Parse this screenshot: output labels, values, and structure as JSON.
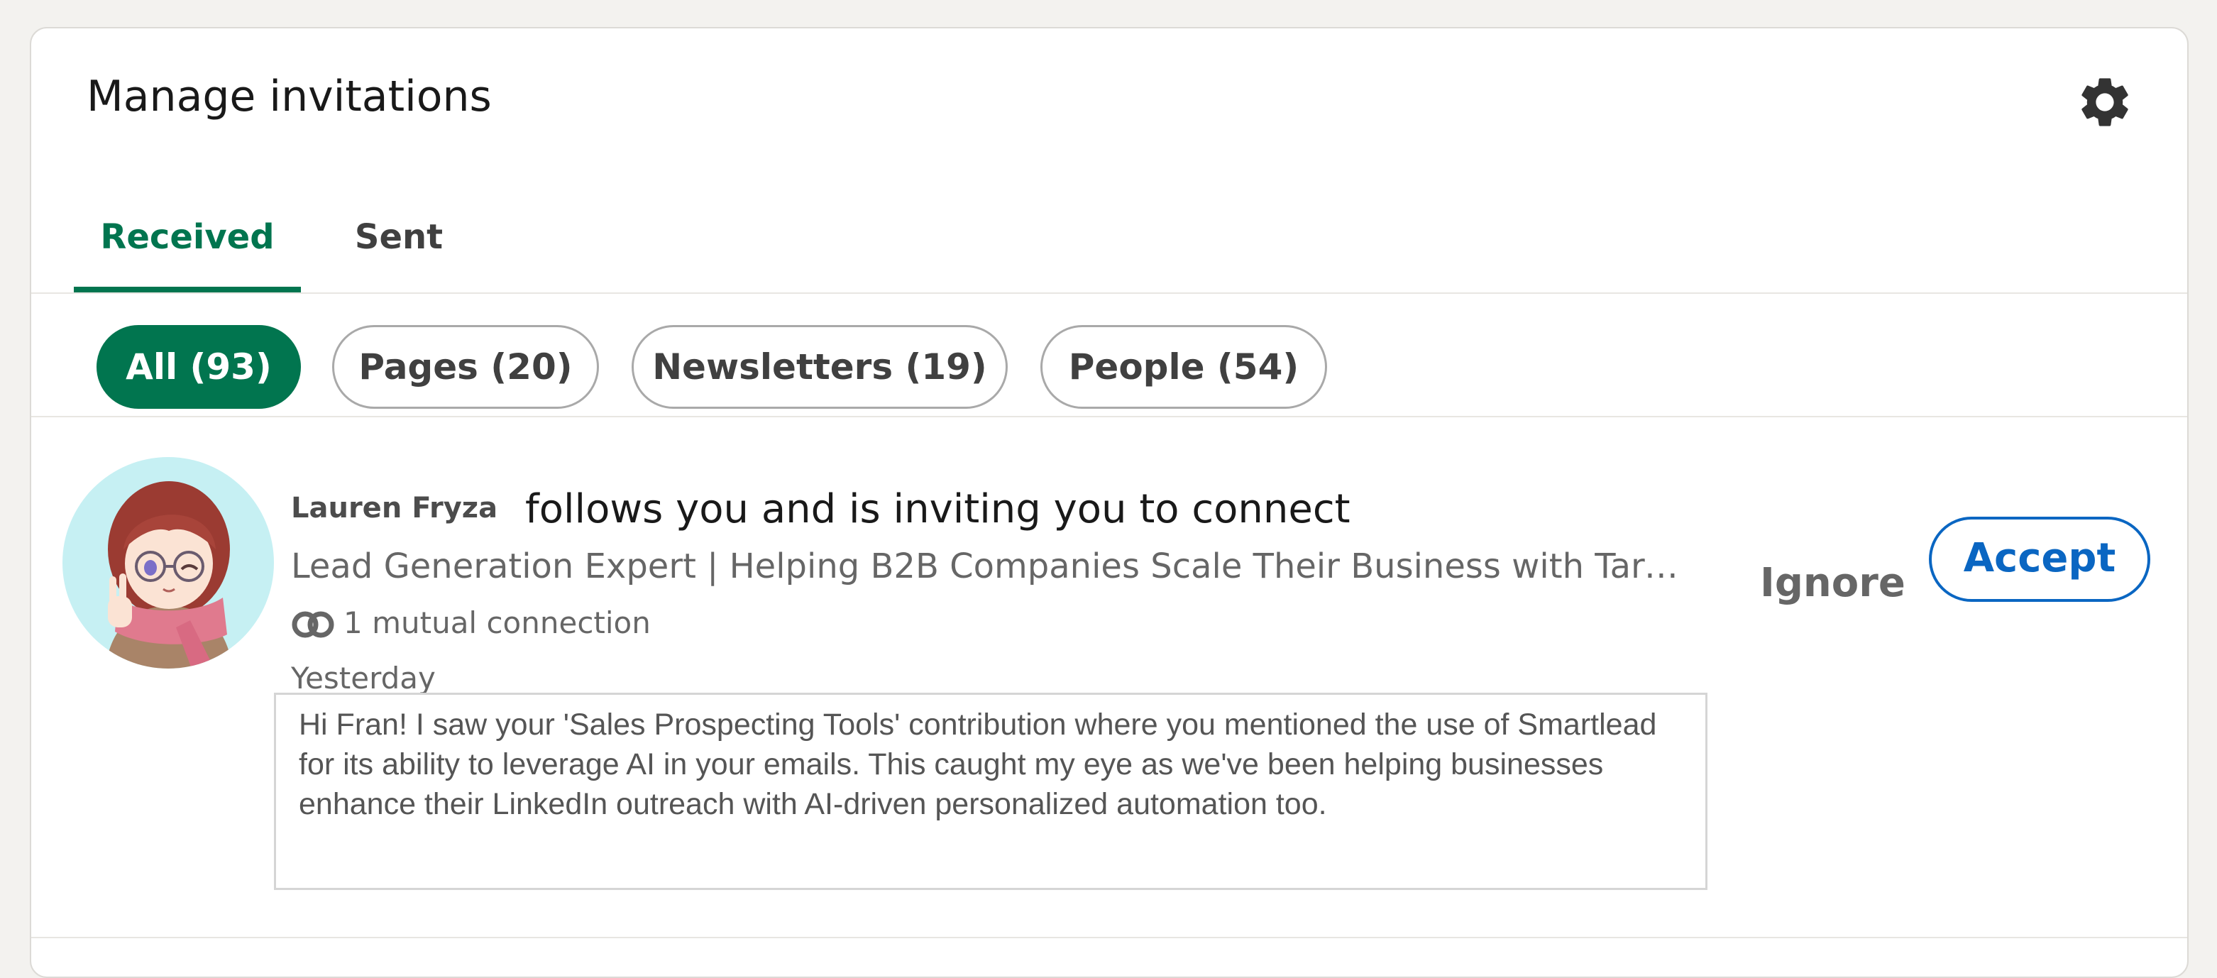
{
  "header": {
    "title": "Manage invitations",
    "settings_icon": "gear-icon"
  },
  "tabs": [
    {
      "label": "Received",
      "active": true
    },
    {
      "label": "Sent",
      "active": false
    }
  ],
  "filters": [
    {
      "label": "All (93)",
      "active": true
    },
    {
      "label": "Pages (20)",
      "active": false
    },
    {
      "label": "Newsletters (19)",
      "active": false
    },
    {
      "label": "People (54)",
      "active": false
    }
  ],
  "invitation": {
    "name": "Lauren Fryza",
    "action_text": "follows you and is inviting you to connect",
    "headline": "Lead Generation Expert | Helping B2B Companies Scale Their Business with Targete...",
    "mutual_icon": "mutual-connections-icon",
    "mutual": "1 mutual connection",
    "time": "Yesterday",
    "message": "Hi Fran! I saw your 'Sales Prospecting Tools' contribution where you mentioned the use of Smartlead for its ability to leverage AI in your emails. This caught my eye as we've been helping businesses enhance their LinkedIn outreach with AI-driven personalized automation too.",
    "ignore_label": "Ignore",
    "accept_label": "Accept"
  },
  "colors": {
    "brand_green": "#01754f",
    "accept_blue": "#0a66c2",
    "page_background": "#f3f2ef",
    "avatar_background": "#c6f0f3"
  }
}
